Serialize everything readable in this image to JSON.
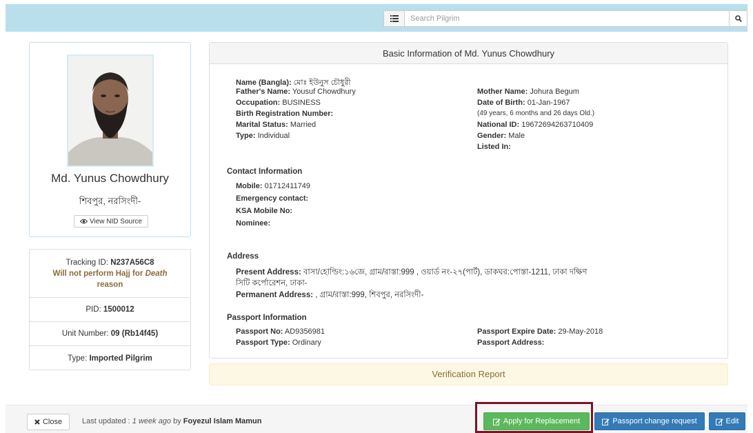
{
  "search": {
    "placeholder": "Search Pilgrim"
  },
  "profile": {
    "name": "Md. Yunus Chowdhury",
    "location": "শিবপুর, নরসিংদী-",
    "nid_button": "View NID Source"
  },
  "status": {
    "tracking_label": "Tracking ID: ",
    "tracking_id": "N237A56C8",
    "warning_prefix": "Will not perform Hajj for ",
    "warning_reason_word": "Death",
    "warning_suffix": "reason",
    "pid_label": "PID: ",
    "pid": "1500012",
    "unit_label": "Unit Number: ",
    "unit": "09 (Rb14f45)",
    "type_label": "Type: ",
    "type": "Imported Pilgrim"
  },
  "basic_info": {
    "title": "Basic Information of Md. Yunus Chowdhury",
    "name_bangla_label": "Name (Bangla):",
    "name_bangla": "মোঃ ইউনুস চৌধুরী",
    "father_label": "Father's Name:",
    "father": "Yousuf Chowdhury",
    "occupation_label": "Occupation:",
    "occupation": "BUSINESS",
    "birth_reg_label": "Birth Registration Number:",
    "birth_reg": "",
    "marital_label": "Marital Status:",
    "marital": "Married",
    "type_label": "Type:",
    "type": "Individual",
    "mother_label": "Mother Name:",
    "mother": "Johura Begum",
    "dob_label": "Date of Birth:",
    "dob": "01-Jan-1967",
    "age": "(49 years, 6 months and 26 days Old.)",
    "nid_label": "National ID:",
    "nid": "19672694263710409",
    "gender_label": "Gender:",
    "gender": "Male",
    "listed_label": "Listed In:",
    "listed": ""
  },
  "contact": {
    "title": "Contact Information",
    "mobile_label": "Mobile:",
    "mobile": "01712411749",
    "emergency_label": "Emergency contact:",
    "ksa_label": "KSA Mobile No:",
    "nominee_label": "Nominee:"
  },
  "address": {
    "title": "Address",
    "present_label": "Present Address:",
    "present_line1": "বাসা/হোল্ডিং:১৬জে, গ্রাম/রাস্তা:999 , ওয়ার্ড নং-২৭(পার্ট), ডাকঘর:পোস্তা-1211, ঢাকা দক্ষিণ",
    "present_line2": "সিটি কর্পোরেশন, ঢাকা-",
    "permanent_label": "Permanent Address:",
    "permanent": ", গ্রাম/রাস্তা:999, শিবপুর, নরসিংদী-"
  },
  "passport": {
    "title": "Passport Information",
    "no_label": "Passport No:",
    "no": "AD9356981",
    "type_label": "Passport Type:",
    "type": "Ordinary",
    "expire_label": "Passport Expire Date:",
    "expire": "29-May-2018",
    "address_label": "Passport Address:"
  },
  "verification": {
    "title": "Verification Report"
  },
  "footer": {
    "close_label": "Close",
    "updated_prefix": "Last updated : ",
    "updated_time": "1 week ago",
    "updated_by": " by ",
    "updated_user": "Foyezul Islam Mamun",
    "apply_label": "Apply for Replacement",
    "passport_change_label": "Passport change request",
    "edit_label": "Edit"
  },
  "colors": {
    "accent_topbar": "#b8dfeb",
    "primary": "#337ab7",
    "success": "#5cb85c",
    "highlight": "#7b1226",
    "warning": "#8a6d3b"
  }
}
